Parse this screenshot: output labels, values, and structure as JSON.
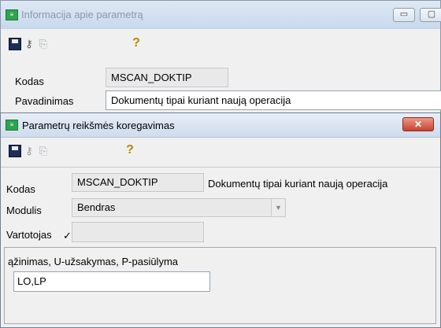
{
  "back_window": {
    "title": "Informacija apie parametrą",
    "minimize_label": "▭",
    "help_glyph": "?",
    "fields": {
      "kodas_label": "Kodas",
      "kodas_value": "MSCAN_DOKTIP",
      "pavadinimas_label": "Pavadinimas",
      "pavadinimas_value": "Dokumentų tipai kuriant naują operacija"
    }
  },
  "dialog": {
    "title": "Parametrų reikšmės koregavimas",
    "close_label": "✕",
    "help_glyph": "?",
    "kodas_label": "Kodas",
    "kodas_value": "MSCAN_DOKTIP",
    "kodas_description": "Dokumentų tipai kuriant naują operacija",
    "modulis_label": "Modulis",
    "modulis_value": "Bendras",
    "vartotojas_label": "Vartotojas",
    "vartotojas_check": "✓",
    "vartotojas_value": "",
    "hint_text": "ąžinimas, U-užsakymas, P-pasiūlyma",
    "value_input": "LO,LP"
  },
  "icons": [
    "save-icon",
    "key-icon",
    "copy-icon",
    "help-icon",
    "close-icon"
  ]
}
